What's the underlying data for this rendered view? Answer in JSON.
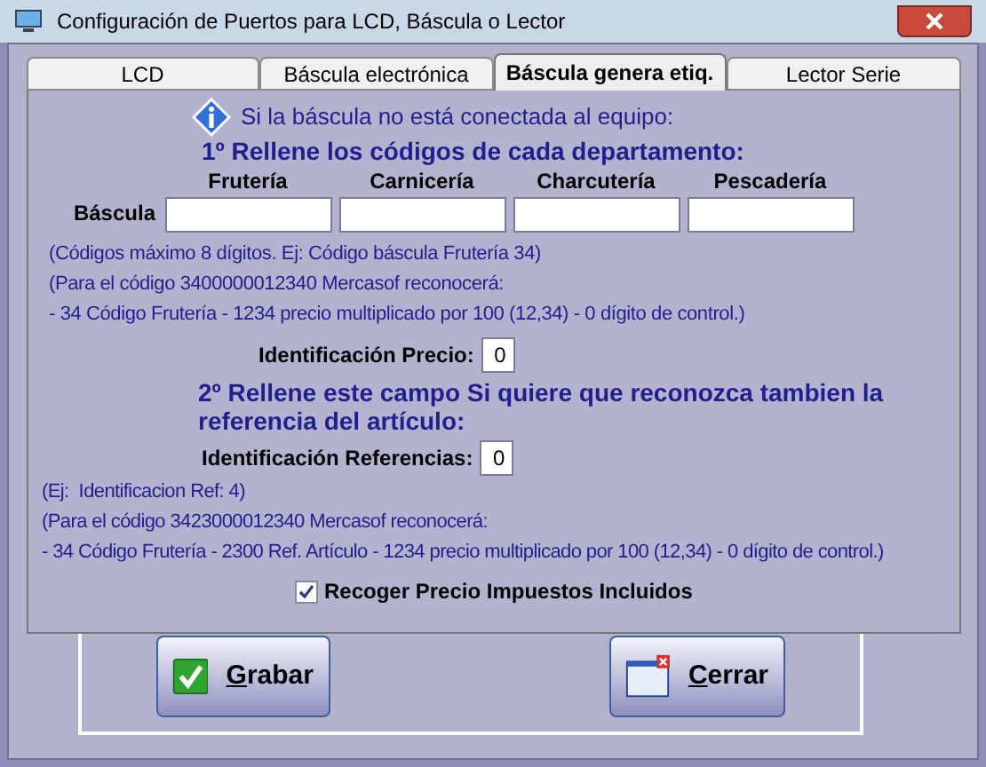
{
  "window": {
    "title": "Configuración de Puertos para LCD, Báscula o Lector"
  },
  "tabs": [
    {
      "label": "LCD",
      "selected": false
    },
    {
      "label": "Báscula electrónica",
      "selected": false
    },
    {
      "label": "Báscula genera etiq.",
      "selected": true
    },
    {
      "label": "Lector Serie",
      "selected": false
    }
  ],
  "info": "Si la báscula no está conectada al equipo:",
  "step1": "1º Rellene los códigos de cada departamento:",
  "departments": {
    "row_label": "Báscula",
    "columns": [
      {
        "label": "Frutería"
      },
      {
        "label": "Carnicería"
      },
      {
        "label": "Charcutería"
      },
      {
        "label": "Pescadería"
      }
    ]
  },
  "notes1": [
    "(Códigos máximo 8 dígitos. Ej: Código báscula Frutería 34)",
    "(Para el código 3400000012340 Mercasof reconocerá:",
    "- 34 Código Frutería - 1234 precio multiplicado por 100 (12,34) - 0 dígito de control.)"
  ],
  "price_id": {
    "label": "Identificación Precio:",
    "value": "0"
  },
  "step2": "2º Rellene este campo Si quiere que reconozca tambien la referencia del artículo:",
  "ref_id": {
    "label": "Identificación Referencias:",
    "value": "0"
  },
  "notes2": [
    "(Ej:  Identificacion Ref: 4)",
    "(Para el código 3423000012340 Mercasof reconocerá:",
    "- 34 Código Frutería - 2300 Ref. Artículo - 1234 precio multiplicado por 100 (12,34) - 0 dígito de control.)"
  ],
  "tax_included": {
    "label": "Recoger Precio Impuestos Incluidos",
    "checked": true
  },
  "buttons": [
    {
      "kind": "save",
      "label": "Grabar"
    },
    {
      "kind": "close",
      "label": "Cerrar"
    }
  ]
}
